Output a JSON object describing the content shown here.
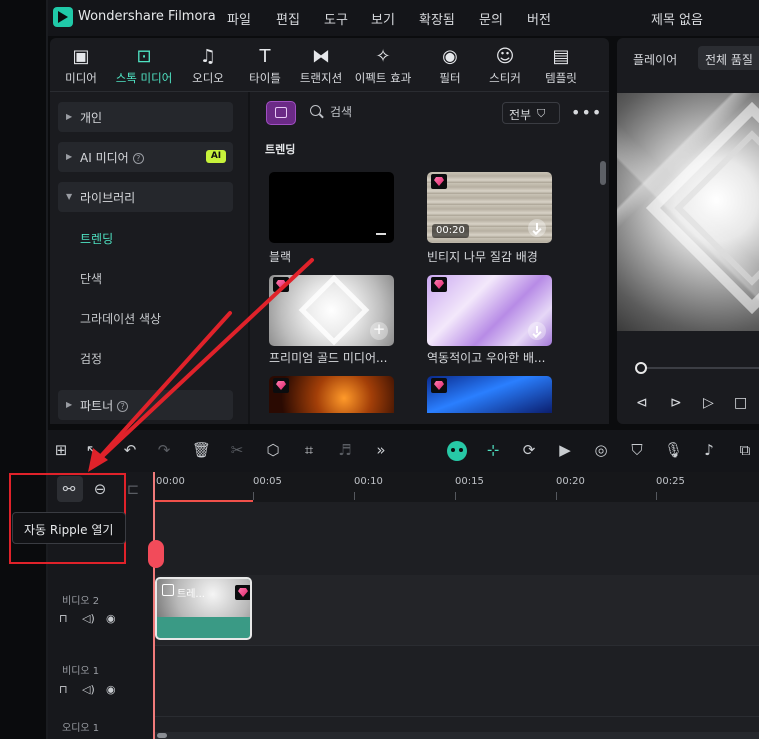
{
  "app": {
    "name": "Wondershare Filmora",
    "doc_title": "제목 없음"
  },
  "menu": [
    "파일",
    "편집",
    "도구",
    "보기",
    "확장됨",
    "문의",
    "버전"
  ],
  "tabs": [
    {
      "label": "미디어",
      "icon": "media-icon"
    },
    {
      "label": "스톡 미디어",
      "icon": "stock-media-icon"
    },
    {
      "label": "오디오",
      "icon": "audio-icon"
    },
    {
      "label": "타이틀",
      "icon": "title-icon"
    },
    {
      "label": "트랜지션",
      "icon": "transition-icon"
    },
    {
      "label": "이펙트 효과",
      "icon": "effects-icon"
    },
    {
      "label": "필터",
      "icon": "filter-icon"
    },
    {
      "label": "스티커",
      "icon": "sticker-icon"
    },
    {
      "label": "템플릿",
      "icon": "template-icon"
    }
  ],
  "sidebar": {
    "personal": "개인",
    "ai_media": "AI 미디어",
    "ai_badge": "AI",
    "library": "라이브러리",
    "library_items": [
      "트렌딩",
      "단색",
      "그라데이션 색상",
      "검정"
    ],
    "partner": "파트너"
  },
  "content": {
    "search_placeholder": "검색",
    "filter_label": "전부",
    "section_title": "트렌딩",
    "items": [
      {
        "label": "블랙",
        "duration": ""
      },
      {
        "label": "빈티지 나무 질감 배경",
        "duration": "00:20"
      },
      {
        "label": "프리미엄 골드 미디어...",
        "duration": ""
      },
      {
        "label": "역동적이고 우아한 배...",
        "duration": ""
      }
    ]
  },
  "player": {
    "tab": "플레이어",
    "quality": "전체 품질"
  },
  "timeline": {
    "ruler": [
      "00:00",
      "00:05",
      "00:10",
      "00:15",
      "00:20",
      "00:25"
    ],
    "tracks": [
      "비디오 2",
      "비디오 1",
      "오디오 1"
    ],
    "clip_label": "트레...",
    "tooltip": "자동 Ripple 열기"
  },
  "colors": {
    "accent": "#4fe2c2",
    "highlight": "#e0222a",
    "playhead": "#f0504a"
  }
}
